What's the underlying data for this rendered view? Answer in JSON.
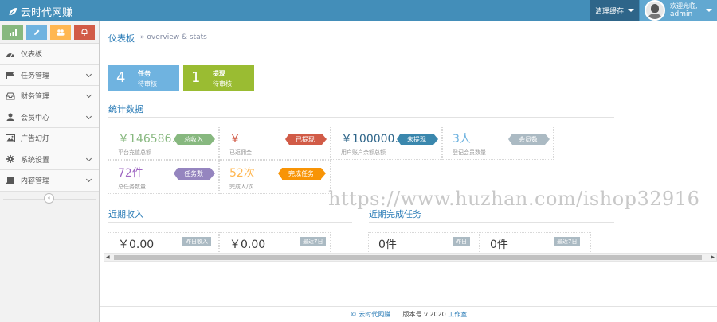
{
  "header": {
    "brand": "云时代网赚",
    "clear_cache": "清理缓存",
    "welcome": "欢迎光临,",
    "username": "admin"
  },
  "sidebar": {
    "items": [
      {
        "label": "仪表板"
      },
      {
        "label": "任务管理"
      },
      {
        "label": "财务管理"
      },
      {
        "label": "会员中心"
      },
      {
        "label": "广告幻灯"
      },
      {
        "label": "系统设置"
      },
      {
        "label": "内容管理"
      }
    ],
    "collapse": "«"
  },
  "breadcrumb": {
    "title": "仪表板",
    "subtitle": "» overview & stats"
  },
  "infoboxes": [
    {
      "number": "4",
      "line1": "任务",
      "line2": "待审核",
      "color": "#6fb3e0"
    },
    {
      "number": "1",
      "line1": "提现",
      "line2": "待审核",
      "color": "#9abc32"
    }
  ],
  "stats": {
    "title": "统计数据",
    "boxes": [
      {
        "value": "￥146586.0",
        "caption": "平台充值总额",
        "tag": "总收入",
        "color": "#87b87f",
        "tag_color": "#87b87f"
      },
      {
        "value": "￥",
        "caption": "已返佣金",
        "tag": "已提现",
        "color": "#d15b47",
        "tag_color": "#d15b47"
      },
      {
        "value": "￥100000.9",
        "caption": "用户账户余额总额",
        "tag": "未提现",
        "color": "#2e6589",
        "tag_color": "#3a87ad"
      },
      {
        "value": "3人",
        "caption": "登记会员数量",
        "tag": "会员数",
        "color": "#6fb3e0",
        "tag_color": "#abbac3"
      },
      {
        "value": "72件",
        "caption": "总任务数量",
        "tag": "任务数",
        "color": "#a069c3",
        "tag_color": "#9585bf"
      },
      {
        "value": "52次",
        "caption": "完成人/次",
        "tag": "完成任务",
        "color": "#ffb752",
        "tag_color": "#f89406"
      }
    ]
  },
  "income": {
    "title": "近期收入",
    "boxes": [
      {
        "value": "￥0.00",
        "badge": "昨日收入"
      },
      {
        "value": "￥0.00",
        "badge": "最近7日"
      }
    ]
  },
  "tasks": {
    "title": "近期完成任务",
    "boxes": [
      {
        "value": "0件",
        "badge": "昨日"
      },
      {
        "value": "0件",
        "badge": "最近7日"
      }
    ]
  },
  "watermark": "https://www.huzhan.com/ishop32916",
  "footer": {
    "brand": "云时代网赚",
    "version_label": "版本号 v 2020",
    "studio": "工作室"
  }
}
